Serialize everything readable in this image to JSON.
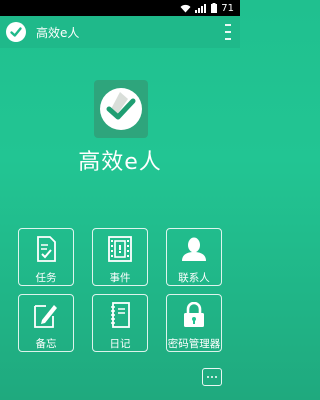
{
  "status_bar": {
    "time": "71"
  },
  "title_bar": {
    "title": "高效e人"
  },
  "app_name": "高效e人",
  "menu_items": [
    {
      "label": "任务",
      "icon": "task-checklist-icon"
    },
    {
      "label": "事件",
      "icon": "event-film-icon"
    },
    {
      "label": "联系人",
      "icon": "contact-person-icon"
    },
    {
      "label": "备忘",
      "icon": "memo-pencil-icon"
    },
    {
      "label": "日记",
      "icon": "diary-notebook-icon"
    },
    {
      "label": "密码管理器",
      "icon": "password-lock-icon"
    }
  ],
  "colors": {
    "background": "#22c593",
    "title_bar": "#1fb98a",
    "logo_tile": "#2ea57c",
    "accent": "#ffffff"
  }
}
